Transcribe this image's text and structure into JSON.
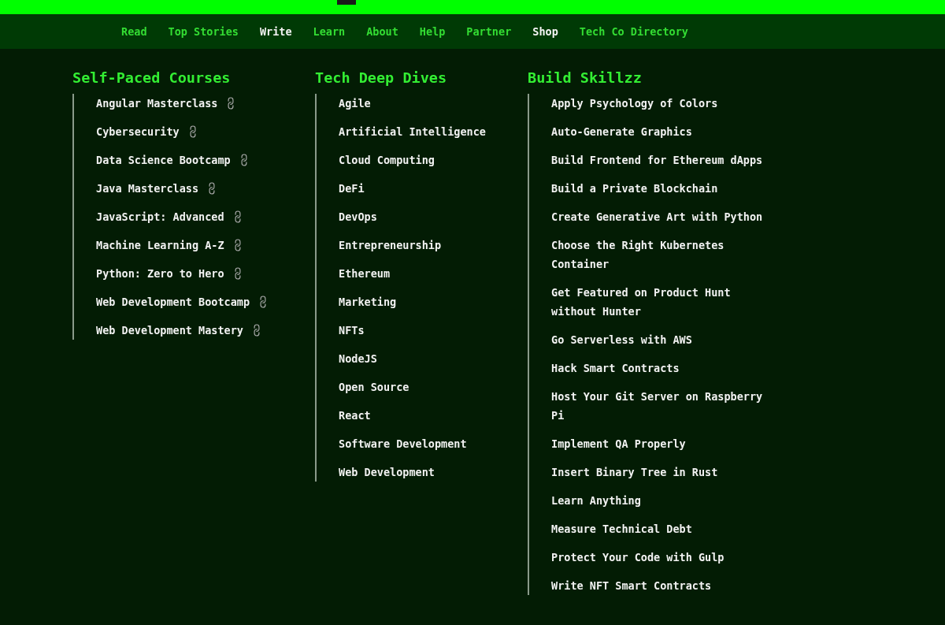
{
  "nav": [
    {
      "label": "Read",
      "highlighted": false
    },
    {
      "label": "Top Stories",
      "highlighted": false
    },
    {
      "label": "Write",
      "highlighted": true
    },
    {
      "label": "Learn",
      "highlighted": false
    },
    {
      "label": "About",
      "highlighted": false
    },
    {
      "label": "Help",
      "highlighted": false
    },
    {
      "label": "Partner",
      "highlighted": false
    },
    {
      "label": "Shop",
      "highlighted": true
    },
    {
      "label": "Tech Co Directory",
      "highlighted": false
    }
  ],
  "columns": [
    {
      "title": "Self-Paced Courses",
      "items": [
        {
          "label": "Angular Masterclass",
          "external": true
        },
        {
          "label": "Cybersecurity",
          "external": true
        },
        {
          "label": "Data Science Bootcamp",
          "external": true
        },
        {
          "label": "Java Masterclass",
          "external": true
        },
        {
          "label": "JavaScript: Advanced",
          "external": true
        },
        {
          "label": "Machine Learning A-Z",
          "external": true
        },
        {
          "label": "Python: Zero to Hero",
          "external": true
        },
        {
          "label": "Web Development Bootcamp",
          "external": true
        },
        {
          "label": "Web Development Mastery",
          "external": true
        }
      ]
    },
    {
      "title": "Tech Deep Dives",
      "items": [
        {
          "label": "Agile"
        },
        {
          "label": "Artificial Intelligence"
        },
        {
          "label": "Cloud Computing"
        },
        {
          "label": "DeFi"
        },
        {
          "label": "DevOps"
        },
        {
          "label": "Entrepreneurship"
        },
        {
          "label": "Ethereum"
        },
        {
          "label": "Marketing"
        },
        {
          "label": "NFTs"
        },
        {
          "label": "NodeJS"
        },
        {
          "label": "Open Source"
        },
        {
          "label": "React"
        },
        {
          "label": "Software Development"
        },
        {
          "label": "Web Development"
        }
      ]
    },
    {
      "title": "Build Skillzz",
      "items": [
        {
          "label": "Apply Psychology of Colors"
        },
        {
          "label": "Auto-Generate Graphics"
        },
        {
          "label": "Build Frontend for Ethereum dApps"
        },
        {
          "label": "Build a Private Blockchain"
        },
        {
          "label": "Create Generative Art with Python"
        },
        {
          "label": "Choose the Right Kubernetes Container"
        },
        {
          "label": "Get Featured on Product Hunt without Hunter"
        },
        {
          "label": "Go Serverless with AWS"
        },
        {
          "label": "Hack Smart Contracts"
        },
        {
          "label": "Host Your Git Server on Raspberry Pi"
        },
        {
          "label": "Implement QA Properly"
        },
        {
          "label": "Insert Binary Tree in Rust"
        },
        {
          "label": "Learn Anything"
        },
        {
          "label": "Measure Technical Debt"
        },
        {
          "label": "Protect Your Code with Gulp"
        },
        {
          "label": "Write NFT Smart Contracts"
        }
      ]
    }
  ]
}
